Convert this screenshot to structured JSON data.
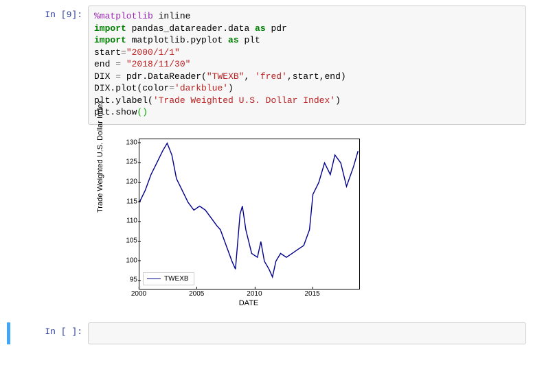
{
  "cell1": {
    "prompt_prefix": "In [",
    "prompt_num": "9",
    "prompt_suffix": "]:",
    "code": {
      "l1_magic": "%matplotlib",
      "l1_arg": " inline",
      "l2_import": "import",
      "l2_mod": " pandas_datareader.data ",
      "l2_as": "as",
      "l2_alias": " pdr",
      "l3_import": "import",
      "l3_mod": " matplotlib.pyplot ",
      "l3_as": "as",
      "l3_alias": " plt",
      "l4_var": "start",
      "l4_eq": "=",
      "l4_str": "\"2000/1/1\"",
      "l5_var": "end ",
      "l5_eq": "=",
      "l5_str": " \"2018/11/30\"",
      "l6_var": "DIX ",
      "l6_eq": "=",
      "l6_call": " pdr.DataReader(",
      "l6_s1": "\"TWEXB\"",
      "l6_c1": ", ",
      "l6_s2": "'fred'",
      "l6_c2": ",start,end)",
      "l7_a": "DIX.plot(color",
      "l7_eq": "=",
      "l7_s": "'darkblue'",
      "l7_b": ")",
      "l8_a": "plt.ylabel(",
      "l8_s": "'Trade Weighted U.S. Dollar Index'",
      "l8_b": ")",
      "l9_a": "plt.show",
      "l9_p1": "(",
      "l9_p2": ")"
    }
  },
  "chart_data": {
    "type": "line",
    "title": "",
    "ylabel": "Trade Weighted U.S. Dollar Index",
    "xlabel": "DATE",
    "legend": "TWEXB",
    "xlim": [
      2000,
      2019
    ],
    "ylim": [
      93,
      131
    ],
    "yticks": [
      95,
      100,
      105,
      110,
      115,
      120,
      125,
      130
    ],
    "xticks": [
      2000,
      2005,
      2010,
      2015
    ],
    "series": [
      {
        "name": "TWEXB",
        "color": "#00008B",
        "x": [
          2000.0,
          2000.5,
          2001.0,
          2001.5,
          2002.0,
          2002.4,
          2002.8,
          2003.2,
          2003.7,
          2004.2,
          2004.7,
          2005.2,
          2005.7,
          2006.2,
          2006.7,
          2007.0,
          2007.5,
          2008.0,
          2008.3,
          2008.7,
          2008.9,
          2009.2,
          2009.7,
          2010.2,
          2010.5,
          2010.8,
          2011.2,
          2011.5,
          2011.8,
          2012.2,
          2012.7,
          2013.2,
          2013.7,
          2014.2,
          2014.7,
          2015.0,
          2015.5,
          2016.0,
          2016.5,
          2016.9,
          2017.4,
          2017.9,
          2018.5,
          2018.9
        ],
        "values": [
          115,
          118,
          122,
          125,
          128,
          130,
          127,
          121,
          118,
          115,
          113,
          114,
          113,
          111,
          109,
          108,
          104,
          100,
          98,
          112,
          114,
          108,
          102,
          101,
          105,
          100,
          98,
          96,
          100,
          102,
          101,
          102,
          103,
          104,
          108,
          117,
          120,
          125,
          122,
          127,
          125,
          119,
          124,
          128
        ]
      }
    ]
  },
  "cell2": {
    "prompt_prefix": "In [",
    "prompt_num": " ",
    "prompt_suffix": "]:"
  }
}
